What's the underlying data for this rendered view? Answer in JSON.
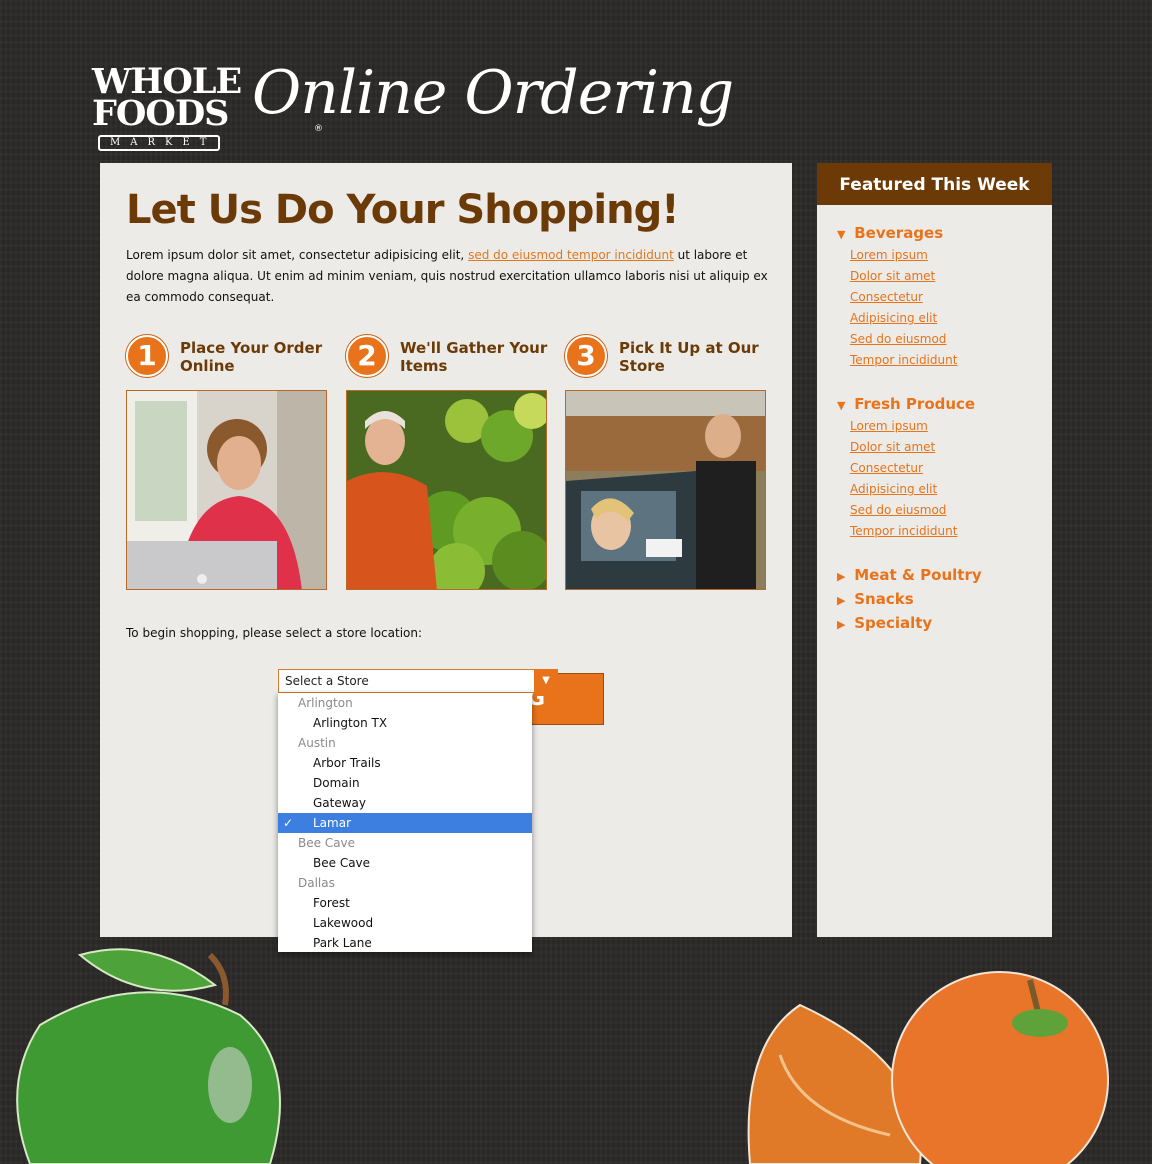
{
  "header": {
    "logo_line1": "WHOLE",
    "logo_line2": "FOODS",
    "logo_line3": "MARKET",
    "logo_reg": "®",
    "app_title": "Online Ordering"
  },
  "main": {
    "title": "Let Us Do Your Shopping!",
    "intro_before": "Lorem ipsum dolor sit amet, consectetur adipisicing elit, ",
    "intro_link": "sed do eiusmod tempor incididunt",
    "intro_after": " ut labore et dolore magna aliqua. Ut enim ad minim veniam, quis nostrud exercitation ullamco laboris nisi ut aliquip ex ea commodo consequat.",
    "steps": [
      {
        "number": "1",
        "label": "Place Your Order Online"
      },
      {
        "number": "2",
        "label": "We'll Gather Your Items"
      },
      {
        "number": "3",
        "label": "Pick It Up at Our Store"
      }
    ],
    "begin_text": "To begin shopping, please select a store location:",
    "start_button_partial": "G"
  },
  "store_select": {
    "placeholder": "Select a Store",
    "arrow": "▼",
    "selected_value": "Lamar",
    "check": "✓",
    "groups": [
      {
        "name": "Arlington",
        "options": [
          "Arlington TX"
        ]
      },
      {
        "name": "Austin",
        "options": [
          "Arbor Trails",
          "Domain",
          "Gateway",
          "Lamar"
        ]
      },
      {
        "name": "Bee Cave",
        "options": [
          "Bee Cave"
        ]
      },
      {
        "name": "Dallas",
        "options": [
          "Forest",
          "Lakewood",
          "Park Lane"
        ]
      }
    ]
  },
  "sidebar": {
    "header": "Featured This Week",
    "expanded_icon": "▼",
    "collapsed_icon": "▶",
    "categories": [
      {
        "label": "Beverages",
        "items": [
          "Lorem ipsum",
          "Dolor sit amet",
          "Consectetur",
          "Adipisicing elit",
          "Sed do eiusmod",
          "Tempor incididunt"
        ]
      },
      {
        "label": "Fresh Produce",
        "items": [
          "Lorem ipsum",
          "Dolor sit amet",
          "Consectetur",
          "Adipisicing elit",
          "Sed do eiusmod",
          "Tempor incididunt"
        ]
      },
      {
        "label": "Meat & Poultry"
      },
      {
        "label": "Snacks"
      },
      {
        "label": "Specialty"
      }
    ]
  },
  "colors": {
    "brand_brown": "#6b3a07",
    "accent_orange": "#e8731a",
    "panel_bg": "#ecebe8",
    "chalkboard": "#2b2a29",
    "selection_blue": "#3d7fe0"
  }
}
